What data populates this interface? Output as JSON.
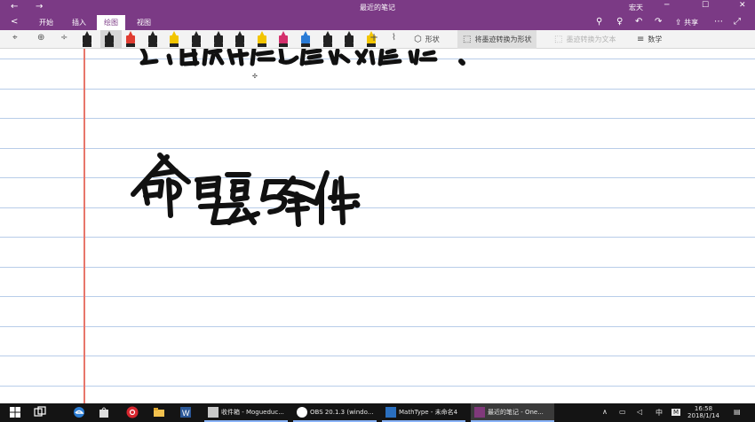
{
  "titlebar": {
    "back_glyph": "←",
    "forward_glyph": "→",
    "title": "最近的笔记",
    "user": "宏天",
    "min_glyph": "─",
    "max_glyph": "☐",
    "close_glyph": "✕"
  },
  "ribbon": {
    "back_glyph": "<",
    "tabs": [
      {
        "label": "开始"
      },
      {
        "label": "插入"
      },
      {
        "label": "绘图"
      },
      {
        "label": "视图"
      }
    ],
    "active_tab": "绘图",
    "share_label": "共享",
    "icons": {
      "search": "⚲",
      "lightbulb": "♀",
      "undo": "↶",
      "redo": "↷",
      "more": "⋯",
      "fullscreen": "⤢"
    }
  },
  "toolbar": {
    "shapes_label": "形状",
    "ink_to_shape_label": "将墨迹转换为形状",
    "ink_to_text_label": "墨迹转换为文本",
    "math_label": "数学",
    "add_glyph": "+",
    "pen_colors": [
      "#222222",
      "#222222",
      "#e03c31",
      "#222222",
      "#f2c500",
      "#222222",
      "#222222",
      "#222222",
      "#f2c500",
      "#d4306c",
      "#2a7bd6",
      "#222222",
      "#222222",
      "#f2c500"
    ]
  },
  "taskbar": {
    "apps": [
      {
        "label": "收件箱 - Mogueduc..."
      },
      {
        "label": "OBS 20.1.3 (windo..."
      },
      {
        "label": "MathType - 未命名4"
      },
      {
        "label": "最近的笔记 - One..."
      }
    ],
    "ime_label": "中",
    "time": "16:58",
    "date": "2018/1/14"
  }
}
